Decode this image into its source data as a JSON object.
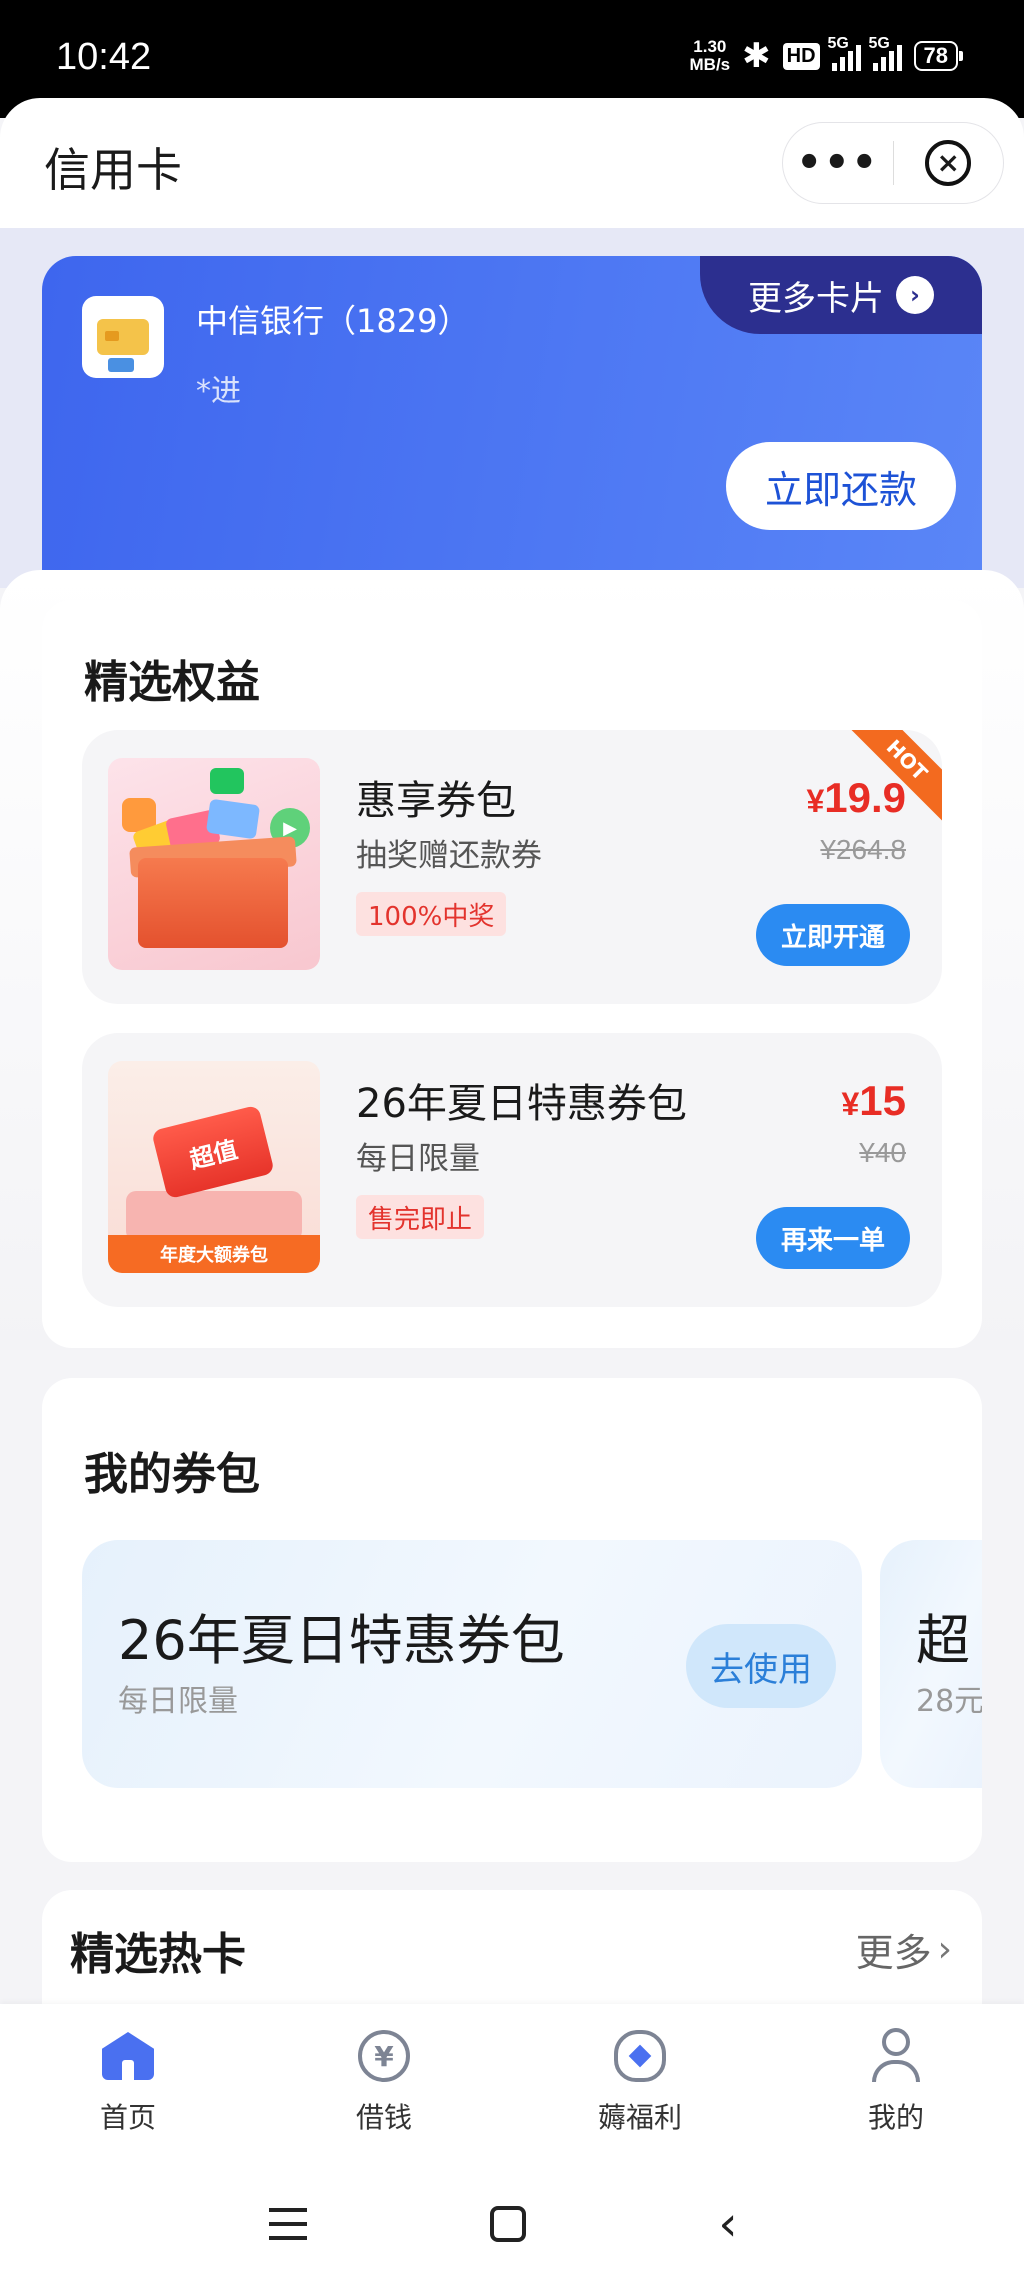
{
  "status_bar": {
    "time": "10:42",
    "net_speed_value": "1.30",
    "net_speed_unit": "MB/s",
    "hd_label": "HD",
    "sim1": "5G",
    "sim2": "5G",
    "battery": "78"
  },
  "header": {
    "title": "信用卡",
    "more_label": "•••",
    "close_label": "×"
  },
  "bank_card": {
    "bank_name": "中信银行（1829）",
    "holder": "*进",
    "more_cards_label": "更多卡片",
    "repay_label": "立即还款"
  },
  "benefits": {
    "title": "精选权益",
    "offers": [
      {
        "name": "惠享券包",
        "subtitle": "抽奖赠还款券",
        "tag": "100%中奖",
        "price": "19.9",
        "original_price": "¥264.8",
        "button": "立即开通",
        "ribbon": "HOT"
      },
      {
        "name": "26年夏日特惠券包",
        "subtitle": "每日限量",
        "tag": "售完即止",
        "price": "15",
        "original_price": "¥40",
        "button": "再来一单",
        "thumb_badge": "超值",
        "thumb_caption": "年度大额券包"
      }
    ],
    "currency_symbol": "¥"
  },
  "my_coupons": {
    "title": "我的券包",
    "items": [
      {
        "name": "26年夏日特惠券包",
        "subtitle": "每日限量",
        "button": "去使用"
      },
      {
        "name": "超",
        "subtitle": "28元"
      }
    ]
  },
  "hot_cards": {
    "title": "精选热卡",
    "more_label": "更多"
  },
  "tabbar": {
    "tabs": [
      {
        "label": "首页",
        "icon": "home-icon",
        "active": true
      },
      {
        "label": "借钱",
        "icon": "yuan-coin-icon"
      },
      {
        "label": "薅福利",
        "icon": "money-bag-icon"
      },
      {
        "label": "我的",
        "icon": "profile-icon"
      }
    ],
    "active_color": "#4a70f0"
  },
  "colors": {
    "card_blue": "#3e66ee",
    "price_red": "#e82d25",
    "button_blue": "#2b8bf2"
  }
}
